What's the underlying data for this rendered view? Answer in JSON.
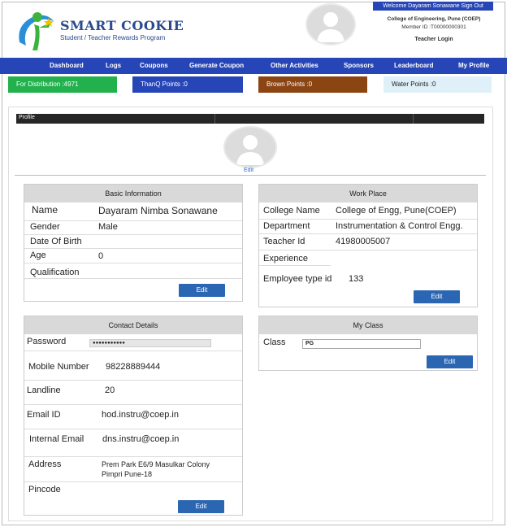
{
  "header": {
    "logo_title": "SMART COOKIE",
    "logo_subtitle": "Student / Teacher Rewards Program",
    "welcome": "Welcome Dayaram Sonawane Sign Out",
    "college": "College of Engineering, Pune (COEP)",
    "member_id": "Member ID :T00000000301",
    "login_type": "Teacher Login"
  },
  "nav": [
    "Dashboard",
    "Logs",
    "Coupons",
    "Generate Coupon",
    "Other Activities",
    "Sponsors",
    "Leaderboard",
    "My Profile"
  ],
  "stats": {
    "distribution": "For Distribution :4971",
    "thanq": "ThanQ Points :0",
    "brown": "Brown Points :0",
    "water": "Water Points :0"
  },
  "colors": {
    "nav": "#2646b8",
    "distribution": "#22b14c",
    "thanq": "#2646b8",
    "brown": "#8b4513",
    "water": "#dff0f8",
    "button": "#2b66b3"
  },
  "profile": {
    "bar_label": "Profile",
    "edit_link": "Edit"
  },
  "basic": {
    "title": "Basic Information",
    "labels": [
      "Name",
      "Gender",
      "Date Of Birth",
      "Age",
      "Qualification"
    ],
    "values": [
      "Dayaram Nimba Sonawane",
      "Male",
      "",
      "0",
      ""
    ],
    "edit": "Edit"
  },
  "work": {
    "title": "Work Place",
    "labels": [
      "College Name",
      "Department",
      "Teacher Id",
      "Experience",
      "Employee type id"
    ],
    "values": [
      "College of Engg, Pune(COEP)",
      "Instrumentation & Control Engg.",
      "41980005007",
      "",
      "133"
    ],
    "edit": "Edit"
  },
  "contact": {
    "title": "Contact Details",
    "labels": [
      "Password",
      "Mobile Number",
      "Landline",
      "Email ID",
      "Internal Email",
      "Address",
      "Pincode"
    ],
    "password": "●●●●●●●●●●●",
    "values": [
      "",
      "98228889444",
      "20",
      "hod.instru@coep.in",
      "dns.instru@coep.in",
      "",
      ""
    ],
    "address_line1": "Prem Park E6/9 Masulkar Colony",
    "address_line2": "Pimpri Pune-18",
    "edit": "Edit"
  },
  "myclass": {
    "title": "My Class",
    "label": "Class",
    "value": "PG",
    "edit": "Edit"
  }
}
